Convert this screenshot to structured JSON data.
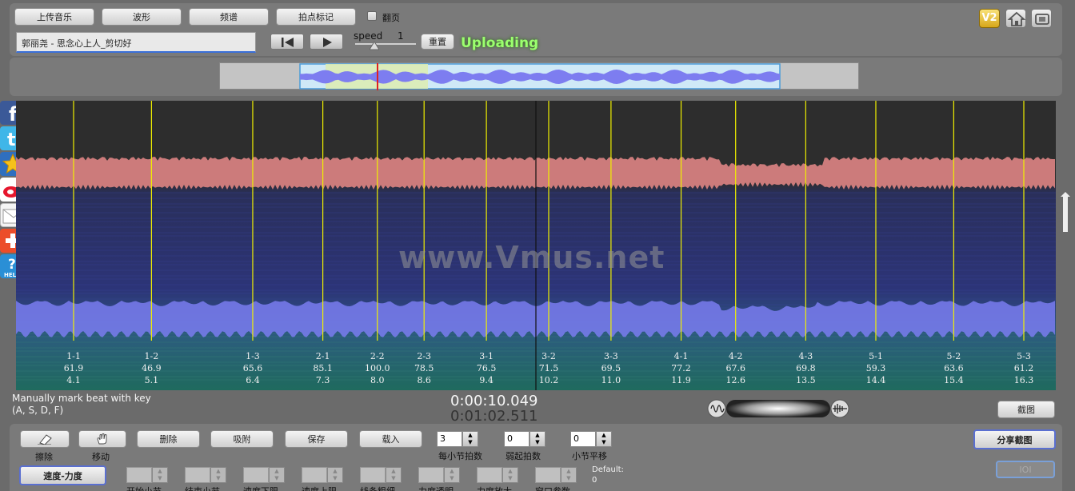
{
  "toolbar": {
    "upload_music": "上传音乐",
    "waveform": "波形",
    "spectrum": "频谱",
    "beat_mark": "拍点标记",
    "flip_page": "翻页",
    "song_title": "郭丽尧 - 思念心上人_剪切好",
    "speed_label": "speed",
    "speed_value": "1",
    "reset": "重置",
    "status": "Uploading",
    "version_badge": "V2"
  },
  "colors": {
    "waveform_band": "#cc7b7b",
    "spectrum_band": "#7a7cf0",
    "beat_line": "#f0f000",
    "accent_blue": "#3a6fd8",
    "status_green": "#9bff6e"
  },
  "beats": [
    {
      "id": "1-1",
      "tempo": "61.9",
      "time": "4.1"
    },
    {
      "id": "1-2",
      "tempo": "46.9",
      "time": "5.1"
    },
    {
      "id": "1-3",
      "tempo": "65.6",
      "time": "6.4"
    },
    {
      "id": "2-1",
      "tempo": "85.1",
      "time": "7.3"
    },
    {
      "id": "2-2",
      "tempo": "100.0",
      "time": "8.0"
    },
    {
      "id": "2-3",
      "tempo": "78.5",
      "time": "8.6"
    },
    {
      "id": "3-1",
      "tempo": "76.5",
      "time": "9.4"
    },
    {
      "id": "3-2",
      "tempo": "71.5",
      "time": "10.2"
    },
    {
      "id": "3-3",
      "tempo": "69.5",
      "time": "11.0"
    },
    {
      "id": "4-1",
      "tempo": "77.2",
      "time": "11.9"
    },
    {
      "id": "4-2",
      "tempo": "67.6",
      "time": "12.6"
    },
    {
      "id": "4-3",
      "tempo": "69.8",
      "time": "13.5"
    },
    {
      "id": "5-1",
      "tempo": "59.3",
      "time": "14.4"
    },
    {
      "id": "5-2",
      "tempo": "63.6",
      "time": "15.4"
    },
    {
      "id": "5-3",
      "tempo": "61.2",
      "time": "16.3"
    }
  ],
  "watermark": "www.Vmus.net",
  "hint": {
    "line1": "Manually mark beat with key",
    "line2": "(A, S, D, F)"
  },
  "time": {
    "current": "0:00:10.049",
    "total": "0:01:02.511"
  },
  "screenshot_button": "截图",
  "bottom": {
    "eraser_label": "擦除",
    "move_label": "移动",
    "delete": "删除",
    "snap": "吸附",
    "save": "保存",
    "load": "载入",
    "beats_per_bar_value": "3",
    "beats_per_bar_label": "每小节拍数",
    "upbeat_value": "0",
    "upbeat_label": "弱起拍数",
    "bar_shift_value": "0",
    "bar_shift_label": "小节平移",
    "share_screenshot": "分享截图",
    "ioi": "IOI",
    "tempo_dynamics": "速度-力度",
    "default_label": "Default:",
    "default_value": "0",
    "param_labels": [
      "开始小节",
      "结束小节",
      "速度下限",
      "速度上限",
      "线条粗细",
      "力度透明",
      "力度放大",
      "窗口参数"
    ]
  },
  "social_icons": [
    "facebook-icon",
    "twitter-icon",
    "favorite-star-icon",
    "weibo-icon",
    "email-icon",
    "more-share-icon",
    "help-icon"
  ],
  "help_text": "HELP"
}
